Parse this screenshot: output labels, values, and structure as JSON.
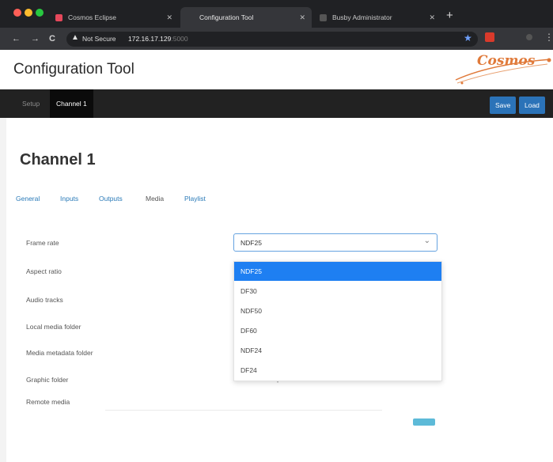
{
  "browser": {
    "tabs": [
      {
        "title": "Cosmos Eclipse",
        "active": false
      },
      {
        "title": "Configuration Tool",
        "active": true
      },
      {
        "title": "Busby Administrator",
        "active": false
      }
    ],
    "security_label": "Not Secure",
    "url_host": "172.16.17.129",
    "url_port": ":5000"
  },
  "app": {
    "title": "Configuration Tool",
    "logo_text": "Cosmos",
    "nav": {
      "setup_label": "Setup",
      "channel_label": "Channel 1",
      "save_label": "Save",
      "load_label": "Load"
    },
    "page_title": "Channel 1",
    "subtabs": [
      "General",
      "Inputs",
      "Outputs",
      "Media",
      "Playlist"
    ],
    "active_subtab": "Media",
    "fields": [
      "Frame rate",
      "Aspect ratio",
      "Audio tracks",
      "Local media folder",
      "Media metadata folder",
      "Graphic folder",
      "Remote media"
    ],
    "frame_rate": {
      "selected": "NDF25",
      "options": [
        "NDF25",
        "DF30",
        "NDF50",
        "DF60",
        "NDF24",
        "DF24"
      ]
    },
    "graphic_folder_value": "C:\\Cosmos\\Graphics"
  },
  "colors": {
    "accent": "#1e7ff2",
    "button": "#2b73b8",
    "link": "#2a7ab8",
    "nav_bg": "#222222",
    "logo": "#e07a3a"
  }
}
